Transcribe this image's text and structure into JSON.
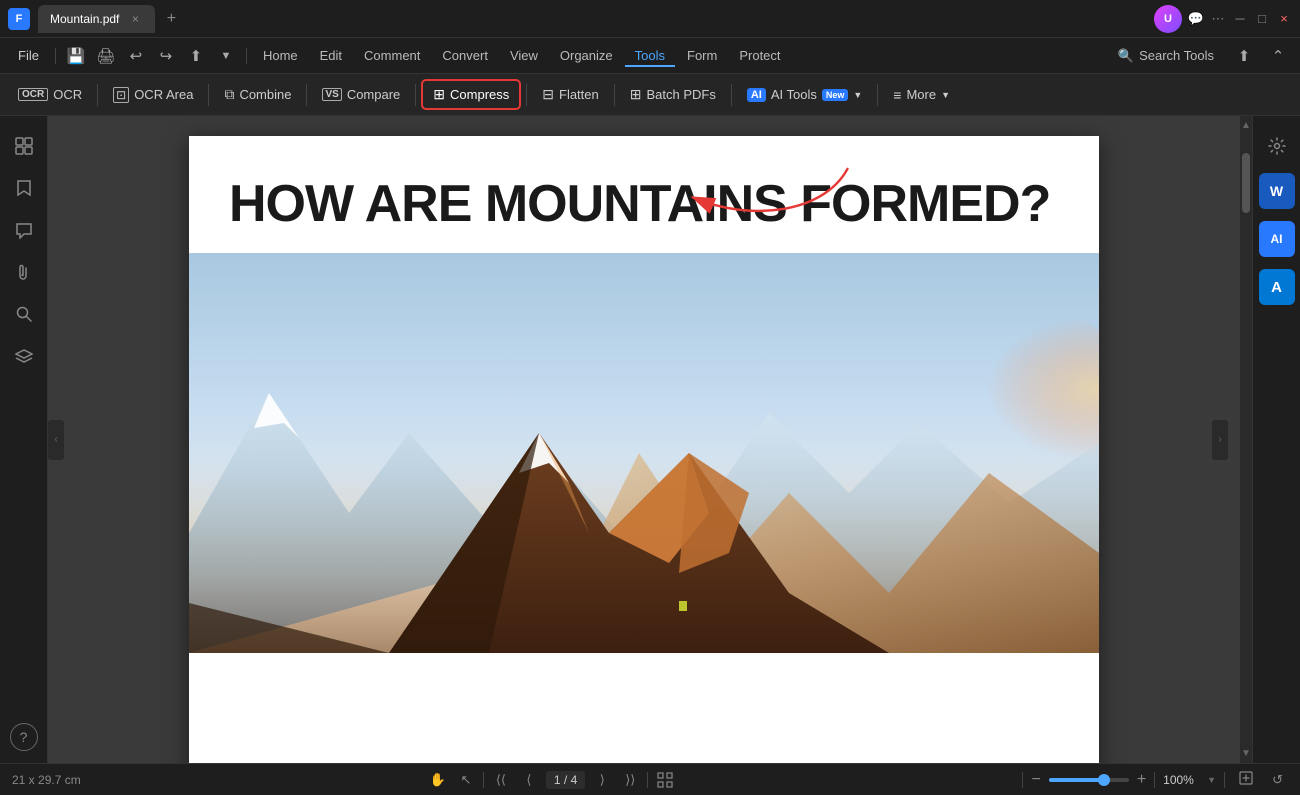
{
  "titleBar": {
    "appLogo": "F",
    "tab": {
      "name": "Mountain.pdf",
      "closeLabel": "×"
    },
    "newTabLabel": "+",
    "controls": {
      "user": "U",
      "chat": "💬",
      "more": "⋯",
      "minimize": "─",
      "maximize": "□",
      "close": "×"
    }
  },
  "menuBar": {
    "fileLabel": "File",
    "icons": [
      "save",
      "print",
      "undo",
      "redo",
      "share",
      "dropdown"
    ],
    "items": [
      "Home",
      "Edit",
      "Comment",
      "Convert",
      "View",
      "Organize",
      "Tools",
      "Form",
      "Protect"
    ],
    "activeItem": "Tools",
    "searchTools": {
      "label": "Search Tools",
      "icon": "🔍"
    },
    "uploadIcon": "⬆"
  },
  "toolbar": {
    "items": [
      {
        "id": "ocr",
        "icon": "OCR",
        "label": "OCR",
        "active": false
      },
      {
        "id": "ocr-area",
        "icon": "⊡",
        "label": "OCR Area",
        "active": false
      },
      {
        "id": "combine",
        "icon": "⧉",
        "label": "Combine",
        "active": false
      },
      {
        "id": "compare",
        "icon": "VS",
        "label": "Compare",
        "active": false
      },
      {
        "id": "compress",
        "icon": "⊞",
        "label": "Compress",
        "active": true
      },
      {
        "id": "flatten",
        "icon": "⊟",
        "label": "Flatten",
        "active": false
      },
      {
        "id": "batch-pdfs",
        "icon": "⊞",
        "label": "Batch PDFs",
        "active": false
      },
      {
        "id": "ai-tools",
        "icon": "AI",
        "label": "AI Tools",
        "isNew": true,
        "active": false
      },
      {
        "id": "more",
        "icon": "≡",
        "label": "More",
        "active": false
      }
    ]
  },
  "leftSidebar": {
    "icons": [
      {
        "id": "page-thumb",
        "symbol": "⊡",
        "tooltip": "Thumbnails"
      },
      {
        "id": "bookmark",
        "symbol": "🔖",
        "tooltip": "Bookmarks"
      },
      {
        "id": "comment",
        "symbol": "💬",
        "tooltip": "Comments"
      },
      {
        "id": "attachment",
        "symbol": "📎",
        "tooltip": "Attachments"
      },
      {
        "id": "search",
        "symbol": "🔍",
        "tooltip": "Search"
      },
      {
        "id": "layers",
        "symbol": "⊞",
        "tooltip": "Layers"
      }
    ],
    "bottomIcons": [
      {
        "id": "help",
        "symbol": "?",
        "tooltip": "Help"
      }
    ]
  },
  "pdfContent": {
    "title": "HOW ARE MOUNTAINS FORMED?",
    "pageNum": "1 / 4"
  },
  "rightSidebar": {
    "buttons": [
      {
        "id": "word",
        "label": "W",
        "type": "word"
      },
      {
        "id": "ai",
        "label": "AI",
        "type": "ai"
      },
      {
        "id": "azure",
        "label": "A",
        "type": "a-blue"
      }
    ],
    "topIcons": [
      {
        "id": "settings",
        "symbol": "⚙",
        "type": "settings"
      }
    ]
  },
  "statusBar": {
    "dimensions": "21 x 29.7 cm",
    "handTool": "✋",
    "cursorTool": "↖",
    "navFirst": "⟨⟨",
    "navPrev": "⟨",
    "pageDisplay": "1 / 4",
    "navNext": "⟩",
    "navLast": "⟩⟩",
    "fitWindow": "⊡",
    "zoomOut": "−",
    "zoomIn": "+",
    "zoomValue": "100%",
    "fitPage": "⊡",
    "rotate": "↺"
  },
  "annotation": {
    "arrowColor": "#e53935",
    "description": "Red arrow pointing from Tools menu to Compress button"
  },
  "colors": {
    "bg": "#1e1e1e",
    "toolbar": "#252525",
    "accent": "#4da6ff",
    "activeMenu": "#4da6ff",
    "compressHighlight": "#e53935"
  }
}
